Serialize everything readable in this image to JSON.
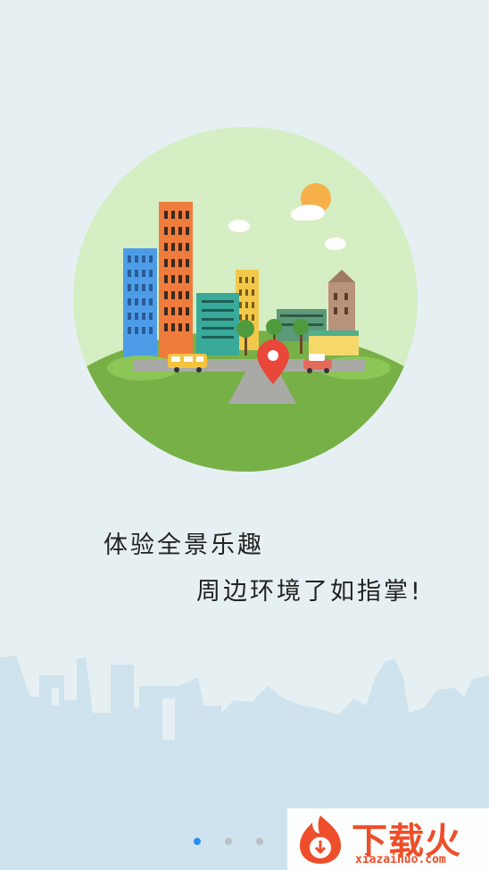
{
  "tagline": {
    "line1": "体验全景乐趣",
    "line2": "周边环境了如指掌!"
  },
  "pager": {
    "count": 3,
    "active_index": 0
  },
  "watermark": {
    "brand": "下载火",
    "url": "xiazaihuo.com"
  },
  "colors": {
    "background": "#e6f0f3",
    "circle_sky": "#d6eec3",
    "grass": "#78b048",
    "pin": "#e8473a",
    "active_dot": "#2a8ef0",
    "inactive_dot": "#b9c0c6",
    "brand": "#ef4a23"
  },
  "icons": {
    "illustration": "city-illustration",
    "pin": "location-pin-icon",
    "logo": "fire-logo-icon"
  }
}
